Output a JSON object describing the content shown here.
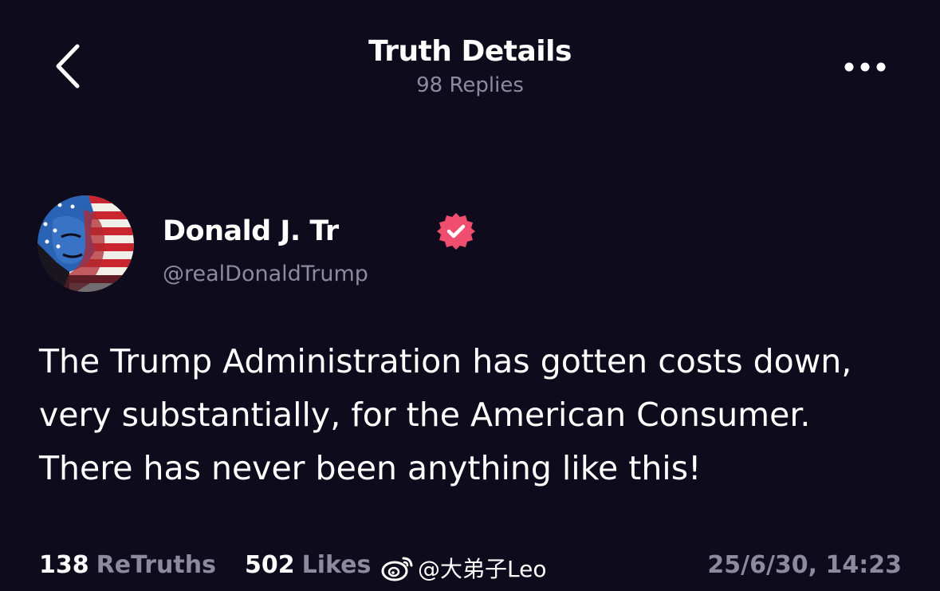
{
  "header": {
    "back_icon": "chevron-left-icon",
    "title": "Truth Details",
    "subtitle": "98 Replies",
    "more_icon": "ellipsis-horizontal-icon"
  },
  "author": {
    "name": "Donald J. Tr                                                                            ",
    "handle": "@realDonaldTrump",
    "verified_icon": "verified-badge-icon",
    "badge_color": "#f04e6e"
  },
  "post": {
    "lines": [
      "The Trump Administration has gotten costs down,",
      "very substantially, for the American Consumer.",
      "There has never been anything like this!"
    ]
  },
  "stats": {
    "retruths_count": "138",
    "retruths_label": "ReTruths",
    "likes_count": "502",
    "likes_label": "Likes"
  },
  "watermark": {
    "icon": "weibo-icon",
    "text": "@大弟子Leo"
  },
  "timestamp": "25/6/30, 14:23",
  "colors": {
    "background": "#0d0b1c",
    "muted_text": "#8d8aa0",
    "primary_text": "#ffffff"
  }
}
